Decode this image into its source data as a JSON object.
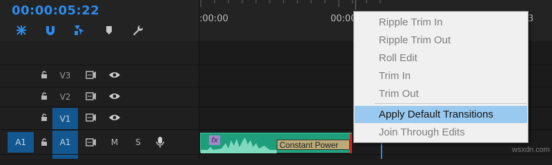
{
  "timecode": "00:00:05:22",
  "ruler": {
    "labels": [
      ":00:00",
      "00:00",
      "3"
    ]
  },
  "tracks": [
    {
      "id": "V3",
      "label": "V3",
      "target": false
    },
    {
      "id": "V2",
      "label": "V2",
      "target": false
    },
    {
      "id": "V1",
      "label": "V1",
      "target": true
    },
    {
      "id": "A1",
      "source_label": "A1",
      "label": "A1",
      "mute": "M",
      "solo": "S",
      "target": true
    }
  ],
  "clip": {
    "fx_label": "fx",
    "transition_label": "Constant Power"
  },
  "context_menu": {
    "items": [
      {
        "label": "Ripple Trim In",
        "enabled": false,
        "highlighted": false
      },
      {
        "label": "Ripple Trim Out",
        "enabled": false,
        "highlighted": false
      },
      {
        "label": "Roll Edit",
        "enabled": false,
        "highlighted": false
      },
      {
        "label": "Trim In",
        "enabled": false,
        "highlighted": false
      },
      {
        "label": "Trim Out",
        "enabled": false,
        "highlighted": false
      },
      {
        "label": "Apply Default Transitions",
        "enabled": true,
        "highlighted": true
      },
      {
        "label": "Join Through Edits",
        "enabled": false,
        "highlighted": false
      }
    ]
  },
  "watermark": "wsxdn.com",
  "colors": {
    "accent": "#2d8ceb",
    "target": "#12578f",
    "clip": "#1f9e7c",
    "menu_highlight": "#99c9ef"
  }
}
